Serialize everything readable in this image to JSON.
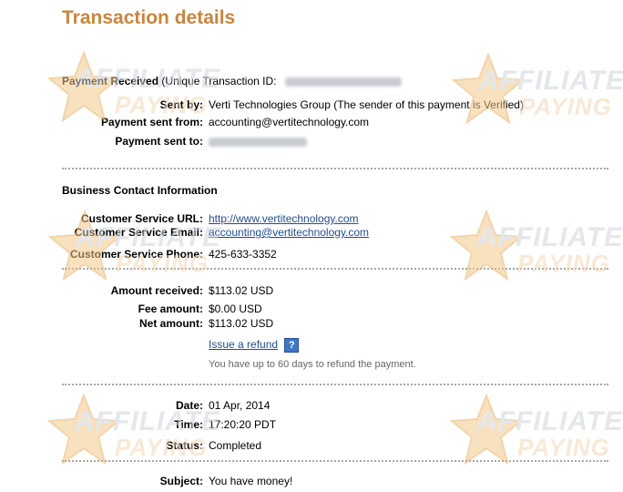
{
  "title": "Transaction details",
  "payment_received": {
    "label": "Payment Received",
    "unique_id_label": "(Unique Transaction ID:"
  },
  "sender": {
    "sent_by_label": "Sent by:",
    "sent_by_value": "Verti Technologies Group (The sender of this payment is Verified)",
    "sent_from_label": "Payment sent from:",
    "sent_from_value": "accounting@vertitechnology.com",
    "sent_to_label": "Payment sent to:"
  },
  "business_contact": {
    "heading": "Business Contact Information",
    "url_label": "Customer Service URL:",
    "url_value": "http://www.vertitechnology.com",
    "email_label": "Customer Service Email:",
    "email_value": "accounting@vertitechnology.com",
    "phone_label": "Customer Service Phone:",
    "phone_value": "425-633-3352"
  },
  "amounts": {
    "received_label": "Amount received:",
    "received_value": "$113.02 USD",
    "fee_label": "Fee amount:",
    "fee_value": "$0.00 USD",
    "net_label": "Net amount:",
    "net_value": "$113.02 USD",
    "refund_link": "Issue a refund",
    "refund_note": "You have up to 60 days to refund the payment."
  },
  "meta": {
    "date_label": "Date:",
    "date_value": "01 Apr, 2014",
    "time_label": "Time:",
    "time_value": "17:20:20 PDT",
    "status_label": "Status:",
    "status_value": "Completed"
  },
  "subject": {
    "label": "Subject:",
    "value": "You have money!"
  },
  "watermark": {
    "line1": "AFFILIATE",
    "line2": "PAYING"
  },
  "colors": {
    "title": "#c9853f",
    "link": "#1f4d8c",
    "help_icon": "#3d78c5",
    "divider": "#a6a6a6"
  },
  "icons": {
    "help": "question-mark-icon",
    "watermark": "star-logo-icon"
  }
}
